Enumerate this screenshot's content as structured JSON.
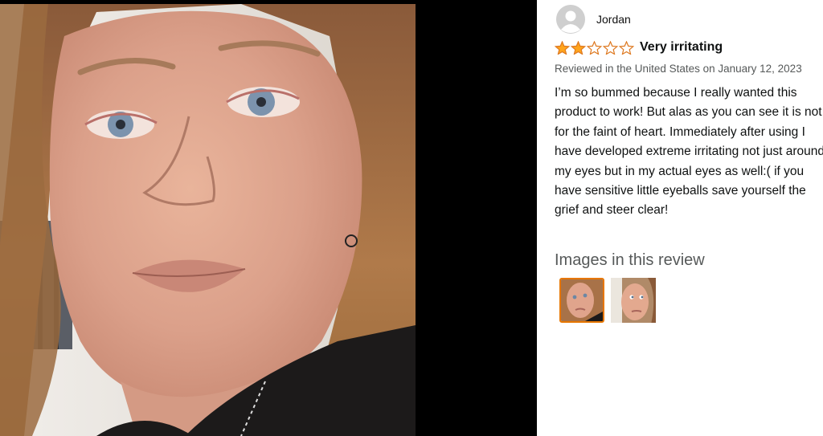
{
  "reviewer": {
    "name": "Jordan",
    "avatar_icon": "user-avatar-icon"
  },
  "rating": {
    "stars": 2,
    "max_stars": 5,
    "star_color": "#ffa41c",
    "empty_star_color": "#de7921"
  },
  "review": {
    "title": "Very irritating",
    "date_text": "Reviewed in the United States on January 12, 2023",
    "body": "I’m so bummed because I really wanted this product to work! But alas as you can see it is not for the faint of heart. Immediately after using I have developed extreme irritating not just around my eyes but in my actual eyes as well:( if you have sensitive little eyeballs save yourself the grief and steer clear!"
  },
  "images_section": {
    "heading": "Images in this review",
    "thumbnails": [
      {
        "name": "review-image-1",
        "selected": true
      },
      {
        "name": "review-image-2",
        "selected": false
      }
    ]
  },
  "colors": {
    "selected_border": "#e77600",
    "viewer_background": "#000000"
  }
}
